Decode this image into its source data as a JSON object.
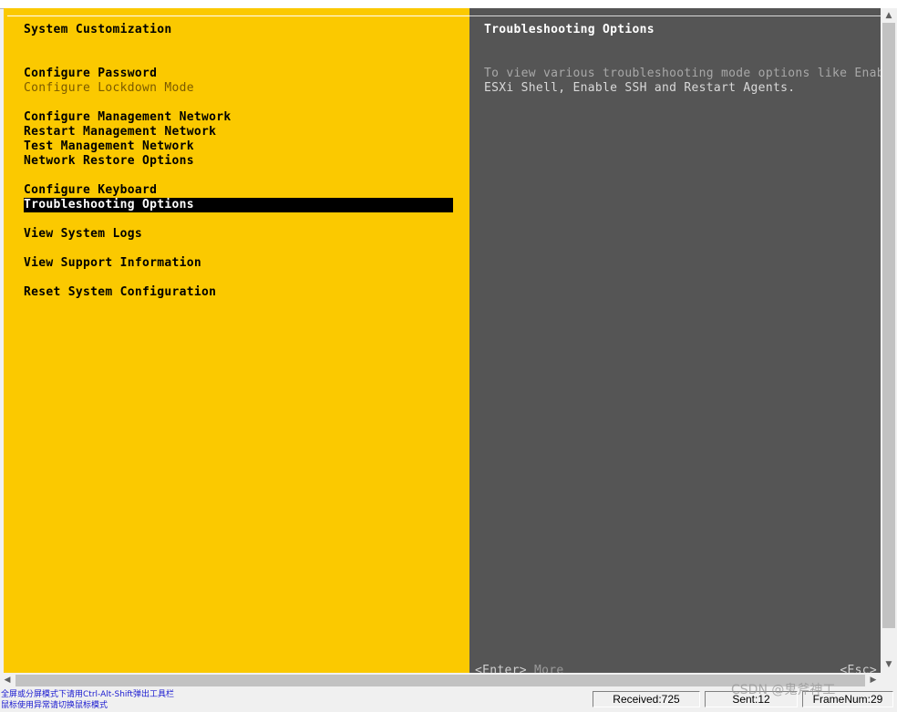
{
  "left": {
    "title": "System Customization",
    "menu": [
      {
        "label": "Configure Password"
      },
      {
        "label": "Configure Lockdown Mode"
      },
      {
        "label": "Configure Management Network"
      },
      {
        "label": "Restart Management Network"
      },
      {
        "label": "Test Management Network"
      },
      {
        "label": "Network Restore Options"
      },
      {
        "label": "Configure Keyboard"
      },
      {
        "label": "Troubleshooting Options"
      },
      {
        "label": "View System Logs"
      },
      {
        "label": "View Support Information"
      },
      {
        "label": "Reset System Configuration"
      }
    ],
    "selected_item": "Troubleshooting Options",
    "footer_key": "<Enter>",
    "footer_action": "More"
  },
  "right": {
    "title": "Troubleshooting Options",
    "description_line1": "To view various troubleshooting mode options like Enab",
    "description_line2": "ESXi Shell, Enable SSH and Restart Agents.",
    "footer_key": "<Esc>"
  },
  "statusbar": {
    "hint_line1": "全屏或分屏模式下请用Ctrl-Alt-Shift弹出工具栏",
    "hint_line2": "鼠标使用异常请切换鼠标模式",
    "received": "Received:725",
    "sent": "Sent:12",
    "frame": "FrameNum:29"
  },
  "watermark": "CSDN @鬼斧神工",
  "colors": {
    "left_panel_bg": "#fbc900",
    "right_panel_bg": "#555555",
    "selection_bg": "#000000",
    "hint_text": "#1a1ad0"
  },
  "icons": {
    "scroll_up": "▲",
    "scroll_down": "▼",
    "scroll_left": "◀",
    "scroll_right": "▶"
  }
}
